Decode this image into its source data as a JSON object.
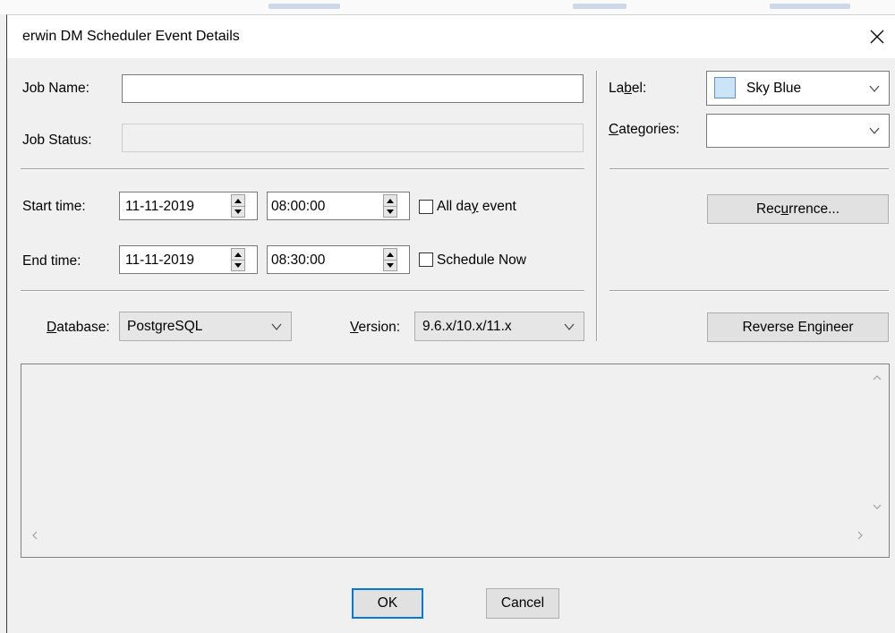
{
  "window": {
    "title": "erwin DM Scheduler Event Details",
    "close_icon": "close-icon"
  },
  "form": {
    "job_name_label": "Job Name:",
    "job_name_value": "",
    "job_status_label": "Job Status:",
    "job_status_value": "",
    "label_label": "Label:",
    "label_value": "Sky Blue",
    "label_color": "#cce4f7",
    "categories_label": "Categories:",
    "categories_value": "",
    "start_time_label": "Start time:",
    "start_date": "11-11-2019",
    "start_time": "08:00:00",
    "end_time_label": "End time:",
    "end_date": "11-11-2019",
    "end_time": "08:30:00",
    "all_day_label": "All day event",
    "all_day_checked": false,
    "schedule_now_label": "Schedule Now",
    "schedule_now_checked": false,
    "database_label": "Database:",
    "database_value": "PostgreSQL",
    "version_label": "Version:",
    "version_value": "9.6.x/10.x/11.x"
  },
  "buttons": {
    "recurrence": "Recurrence...",
    "reverse_engineer": "Reverse Engineer",
    "ok": "OK",
    "cancel": "Cancel"
  },
  "colors": {
    "default_button_border": "#0078d7",
    "button_face": "#e1e1e1",
    "dialog_bg": "#f0f0f0"
  }
}
